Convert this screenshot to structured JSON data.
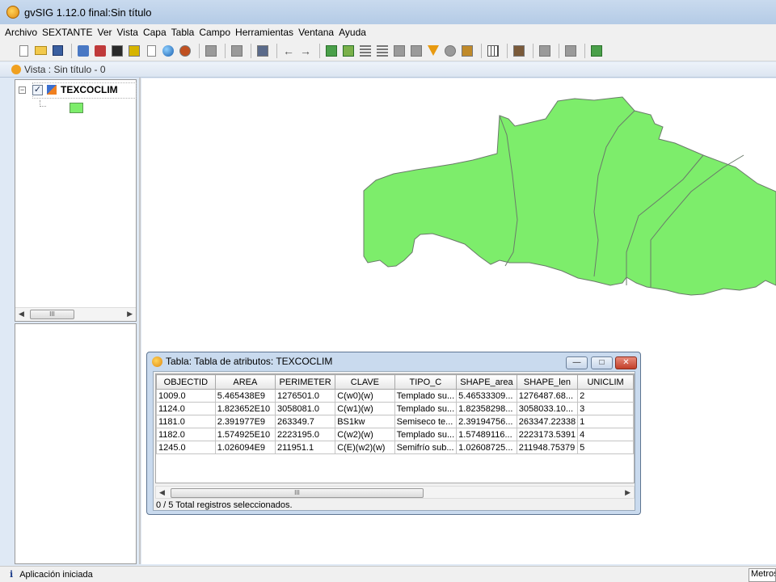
{
  "window": {
    "title": "gvSIG 1.12.0 final:Sin título"
  },
  "menu": [
    "Archivo",
    "SEXTANTE",
    "Ver",
    "Vista",
    "Capa",
    "Tabla",
    "Campo",
    "Herramientas",
    "Ventana",
    "Ayuda"
  ],
  "toolbar": {
    "icons": [
      "new-document-icon",
      "open-folder-icon",
      "save-icon",
      "sextante-toolbox-icon",
      "sextante-modeler-icon",
      "sextante-history-icon",
      "command-line-icon",
      "globe-icon",
      "pointer-icon",
      "grayed-layer-icon",
      "grayed-window-icon",
      "print-icon",
      "back-arrow-icon",
      "forward-arrow-icon",
      "table-link-icon",
      "table-join-icon",
      "sort-ascending-icon",
      "sort-descending-icon",
      "table-icon",
      "table-grid-icon",
      "filter-icon",
      "refresh-icon",
      "field-icon",
      "grid-icon",
      "tools-icon",
      "grayed-icon-1",
      "grayed-icon-2",
      "export-icon"
    ]
  },
  "view": {
    "title": "Vista : Sin título - 0"
  },
  "toc": {
    "layer_name": "TEXCOCLIM",
    "checked": true,
    "legend_color": "#7ded6b"
  },
  "map": {
    "fill_color": "#7ded6b",
    "stroke_color": "#6a7a6a"
  },
  "table_window": {
    "title": "Tabla: Tabla de atributos: TEXCOCLIM",
    "columns": [
      "OBJECTID",
      "AREA",
      "PERIMETER",
      "CLAVE",
      "TIPO_C",
      "SHAPE_area",
      "SHAPE_len",
      "UNICLIM"
    ],
    "rows": [
      [
        "1009.0",
        "5.465438E9",
        "1276501.0",
        "C(w0)(w)",
        "Templado su...",
        "5.46533309...",
        "1276487.68...",
        "2"
      ],
      [
        "1124.0",
        "1.823652E10",
        "3058081.0",
        "C(w1)(w)",
        "Templado su...",
        "1.82358298...",
        "3058033.10...",
        "3"
      ],
      [
        "1181.0",
        "2.391977E9",
        "263349.7",
        "BS1kw",
        "Semiseco te...",
        "2.39194756...",
        "263347.22338",
        "1"
      ],
      [
        "1182.0",
        "1.574925E10",
        "2223195.0",
        "C(w2)(w)",
        "Templado su...",
        "1.57489116...",
        "2223173.5391",
        "4"
      ],
      [
        "1245.0",
        "1.026094E9",
        "211951.1",
        "C(E)(w2)(w)",
        "Semifrío sub...",
        "1.02608725...",
        "211948.75379",
        "5"
      ]
    ],
    "status": "0 / 5 Total registros seleccionados.",
    "scroll_thumb_label": "III"
  },
  "toc_scroll_label": "III",
  "statusbar": {
    "message": "Aplicación iniciada",
    "units": "Metros"
  }
}
